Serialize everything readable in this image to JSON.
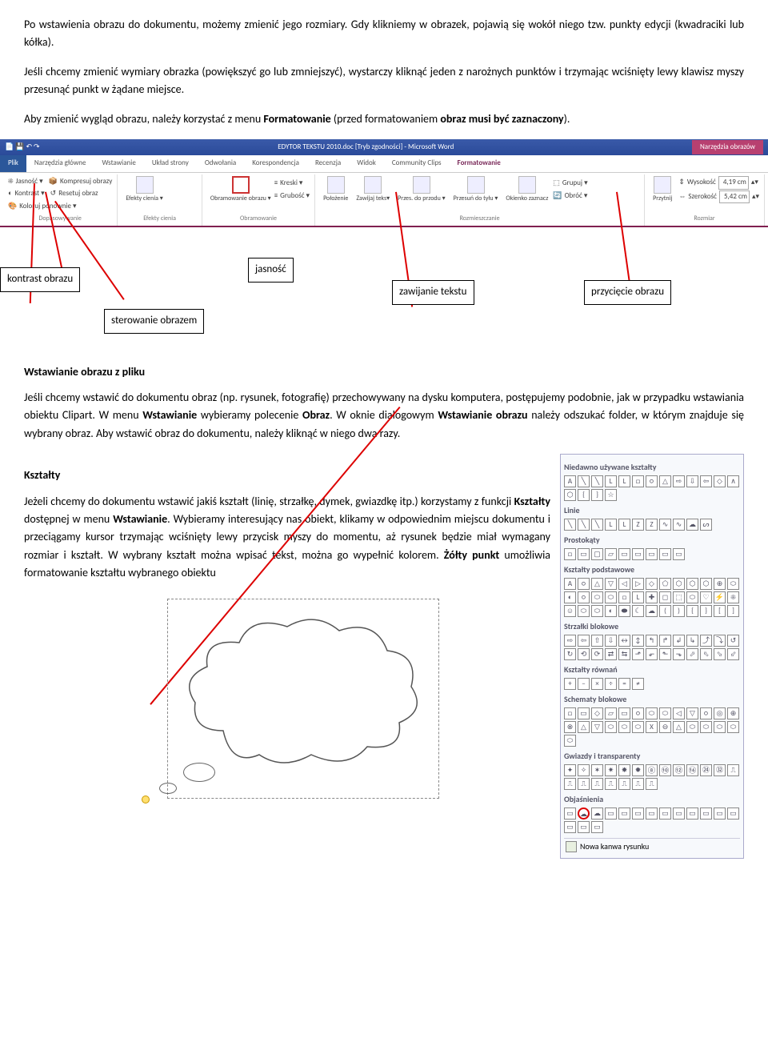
{
  "intro": {
    "p1": "Po wstawienia obrazu do dokumentu, możemy zmienić jego rozmiary. Gdy klikniemy w obrazek, pojawią się wokół niego tzw. punkty edycji (kwadraciki lub kółka).",
    "p2": "Jeśli chcemy zmienić wymiary obrazka (powiększyć go lub zmniejszyć), wystarczy kliknąć jeden z narożnych punktów i trzymając wciśnięty lewy klawisz myszy przesunąć punkt w żądane miejsce.",
    "p3a": "Aby zmienić wygląd obrazu, należy korzystać z menu ",
    "p3b": "Formatowanie",
    "p3c": " (przed formatowaniem ",
    "p3d": "obraz musi być zaznaczony",
    "p3e": ")."
  },
  "ribbon": {
    "title_center": "EDYTOR TEKSTU 2010.doc [Tryb zgodności] - Microsoft Word",
    "title_right": "Narzędzia obrazów",
    "tabs": [
      "Plik",
      "Narzędzia główne",
      "Wstawianie",
      "Układ strony",
      "Odwołania",
      "Korespondencja",
      "Recenzja",
      "Widok",
      "Community Clips",
      "Formatowanie"
    ],
    "g_adjust": {
      "brightness": "Jasność ▾",
      "contrast": "Kontrast ▾",
      "recolor": "Koloruj ponownie ▾",
      "compress": "Kompresuj obrazy",
      "reset": "Resetuj obraz",
      "label": "Dopasowywanie"
    },
    "g_shadow": {
      "btn": "Efekty cienia ▾",
      "label": "Efekty cienia"
    },
    "g_border": {
      "border": "Obramowanie obrazu ▾",
      "lines": "Kreski ▾",
      "weight": "Grubość ▾",
      "label": "Obramowanie"
    },
    "g_arrange": {
      "position": "Położenie",
      "wrap": "Zawijaj teks▾",
      "front": "Przes. do przodu ▾",
      "back": "Przesuń do tyłu ▾",
      "pane": "Okienko zaznacz",
      "group": "Grupuj ▾",
      "rotate": "Obróć ▾",
      "label": "Rozmieszczanie"
    },
    "g_size": {
      "crop": "Przytnij",
      "h": "Wysokość",
      "hval": "4,19 cm",
      "w": "Szerokość",
      "wval": "5,42 cm",
      "label": "Rozmiar"
    }
  },
  "annots": {
    "kontrast": "kontrast obrazu",
    "jasnosc": "jasność",
    "zawijanie": "zawijanie tekstu",
    "przyciecie": "przycięcie obrazu",
    "sterowanie": "sterowanie obrazem"
  },
  "sec_insert": {
    "h": "Wstawianie obrazu z pliku",
    "p1": "Jeśli chcemy wstawić do dokumentu obraz (np. rysunek, fotografię) przechowywany na dysku komputera, postępujemy podobnie, jak w przypadku wstawiania obiektu Clipart. W menu ",
    "p1b": "Wstawianie",
    "p1c": " wybieramy polecenie ",
    "p1d": "Obraz",
    "p1e": ". W oknie dialogowym ",
    "p1f": "Wstawianie obrazu",
    "p1g": " należy odszukać folder, w którym znajduje się wybrany obraz. Aby wstawić obraz do dokumentu, należy kliknąć w niego dwa razy."
  },
  "sec_shapes": {
    "h": "Kształty",
    "p1": "Jeżeli chcemy do dokumentu wstawić jakiś kształt (linię, strzałkę, dymek, gwiazdkę itp.) korzystamy z funkcji ",
    "p1b": "Kształty",
    "p1c": " dostępnej w menu ",
    "p1d": "Wstawianie",
    "p1e": ". Wybieramy interesujący nas obiekt, klikamy w odpowiednim miejscu dokumentu i przeciągamy kursor trzymając wciśnięty lewy przycisk myszy do momentu, aż rysunek będzie miał wymagany rozmiar i kształt. W wybrany kształt można wpisać tekst, można go wypełnić kolorem. ",
    "p1f": "Żółty punkt",
    "p1g": " umożliwia formatowanie kształtu wybranego obiektu"
  },
  "shapes_panel": {
    "recent": "Niedawno używane kształty",
    "lines": "Linie",
    "rects": "Prostokąty",
    "basic": "Kształty podstawowe",
    "arrows": "Strzałki blokowe",
    "eq": "Kształty równań",
    "flow": "Schematy blokowe",
    "stars": "Gwiazdy i transparenty",
    "call": "Objaśnienia",
    "newcanvas": "Nowa kanwa rysunku"
  }
}
